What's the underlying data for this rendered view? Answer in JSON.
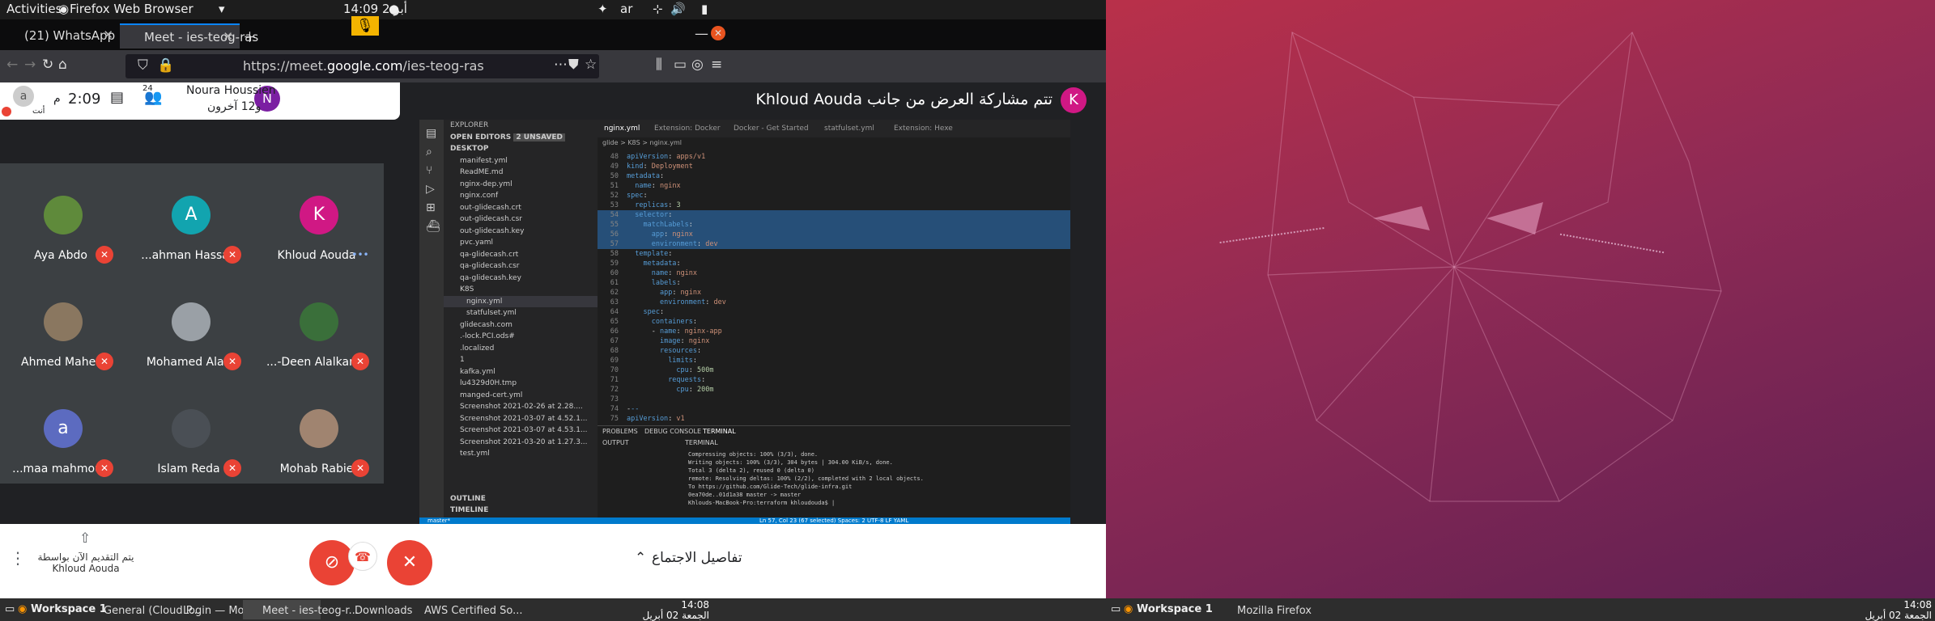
{
  "topbar": {
    "activities": "Activities",
    "app_menu": "Firefox Web Browser",
    "datetime": "14:09  أبر 2",
    "lang": "ar"
  },
  "tabs": [
    {
      "label": "(21) WhatsApp"
    },
    {
      "label": "Meet - ies-teog-ras"
    }
  ],
  "url": {
    "prefix": "https://meet.",
    "domain": "google.com",
    "path": "/ies-teog-ras"
  },
  "meet": {
    "host_name": "Noura Houssien",
    "host_others": "و12 آخرون",
    "time": "2:09",
    "time_suffix": "م",
    "people_count": "24",
    "you_label": "أنت",
    "you_initial": "a",
    "host_initial": "N",
    "presenting_title": "تتم مشاركة العرض من جانب Khloud Aouda",
    "presenter_initial": "K",
    "participants": [
      {
        "name": "Aya Abdo",
        "initial": "",
        "color": "#5f8a3b"
      },
      {
        "name": "...ahman Hassan",
        "initial": "A",
        "color": "#12a4af"
      },
      {
        "name": "Khloud Aouda",
        "initial": "K",
        "color": "#d01884"
      },
      {
        "name": "Ahmed Maher",
        "initial": "",
        "color": "#8a7760"
      },
      {
        "name": "Mohamed Alaa",
        "initial": "",
        "color": "#9aa0a6"
      },
      {
        "name": "...-Deen Alalkamy",
        "initial": "",
        "color": "#3a6f3a"
      },
      {
        "name": "...maa mahmoud",
        "initial": "a",
        "color": "#5c6bc0"
      },
      {
        "name": "Islam Reda",
        "initial": "",
        "color": "#4a4f55"
      },
      {
        "name": "Mohab Rabie",
        "initial": "",
        "color": "#a08470"
      }
    ],
    "presenting_now": "يتم التقديم الآن بواسطة",
    "presenting_now_name": "Khloud Aouda",
    "meeting_details": "تفاصيل الاجتماع"
  },
  "vscode": {
    "explorer": "EXPLORER",
    "open_editors": "OPEN EDITORS",
    "unsaved": "2 UNSAVED",
    "desktop": "DESKTOP",
    "files": [
      "manifest.yml",
      "ReadME.md",
      "nginx-dep.yml",
      "nginx.conf",
      "out-glidecash.crt",
      "out-glidecash.csr",
      "out-glidecash.key",
      "pvc.yaml",
      "qa-glidecash.crt",
      "qa-glidecash.csr",
      "qa-glidecash.key",
      "K8S",
      "nginx.yml",
      "statfulset.yml",
      "glidecash.com",
      ".-lock.PCI.ods#",
      ".localized",
      "1",
      "kafka.yml",
      "lu4329d0H.tmp",
      "manged-cert.yml",
      "Screenshot 2021-02-26 at 2.28....",
      "Screenshot 2021-03-07 at 4.52.1...",
      "Screenshot 2021-03-07 at 4.53.1...",
      "Screenshot 2021-03-20 at 1.27.3...",
      "test.yml"
    ],
    "outline": "OUTLINE",
    "timeline": "TIMELINE",
    "tabs": [
      "nginx.yml",
      "Extension: Docker",
      "Docker - Get Started",
      "statfulset.yml",
      "Extension: Hexe"
    ],
    "breadcrumb": "glide > K8S > nginx.yml",
    "code": [
      [
        "48",
        "apiVersion: apps/v1"
      ],
      [
        "49",
        "kind: Deployment"
      ],
      [
        "50",
        "metadata:"
      ],
      [
        "51",
        "  name: nginx"
      ],
      [
        "52",
        "spec:"
      ],
      [
        "53",
        "  replicas: 3"
      ],
      [
        "54",
        "  selector:"
      ],
      [
        "55",
        "    matchLabels:"
      ],
      [
        "56",
        "      app: nginx"
      ],
      [
        "57",
        "      environment: dev"
      ],
      [
        "58",
        "  template:"
      ],
      [
        "59",
        "    metadata:"
      ],
      [
        "60",
        "      name: nginx"
      ],
      [
        "61",
        "      labels:"
      ],
      [
        "62",
        "        app: nginx"
      ],
      [
        "63",
        "        environment: dev"
      ],
      [
        "64",
        "    spec:"
      ],
      [
        "65",
        "      containers:"
      ],
      [
        "66",
        "      - name: nginx-app"
      ],
      [
        "67",
        "        image: nginx"
      ],
      [
        "68",
        "        resources:"
      ],
      [
        "69",
        "          limits:"
      ],
      [
        "70",
        "            cpu: 500m"
      ],
      [
        "71",
        "          requests:"
      ],
      [
        "72",
        "            cpu: 200m"
      ],
      [
        "73",
        ""
      ],
      [
        "74",
        "---"
      ],
      [
        "75",
        "apiVersion: v1"
      ]
    ],
    "panel_tabs": [
      "PROBLEMS",
      "DEBUG CONSOLE",
      "TERMINAL"
    ],
    "output": "OUTPUT",
    "terminal": "TERMINAL",
    "terminal_lines": [
      "Compressing objects: 100% (3/3), done.",
      "Writing objects: 100% (3/3), 304 bytes | 304.00 KiB/s, done.",
      "Total 3 (delta 2), reused 0 (delta 0)",
      "remote: Resolving deltas: 100% (2/2), completed with 2 local objects.",
      "To https://github.com/Glide-Tech/glide-infra.git",
      "   0ea70de..01d1a38  master -> master",
      "Khlouds-MacBook-Pro:terraform khloudouda$ |"
    ],
    "status_left": "master*",
    "status_right": "Ln 57, Col 23 (67 selected)   Spaces: 2   UTF-8   LF   YAML"
  },
  "taskbar_left": {
    "workspace": "Workspace 1",
    "items": [
      "General (Cloud P...",
      "Login — Mozilla ...",
      "Meet - ies-teog-r...",
      "Downloads",
      "AWS Certified So..."
    ],
    "time": "14:08",
    "date": "الجمعة 02 أبريل"
  },
  "taskbar_right": {
    "workspace": "Workspace 1",
    "items": [
      "Mozilla Firefox"
    ],
    "time": "14:08",
    "date": "الجمعة 02 أبريل"
  }
}
